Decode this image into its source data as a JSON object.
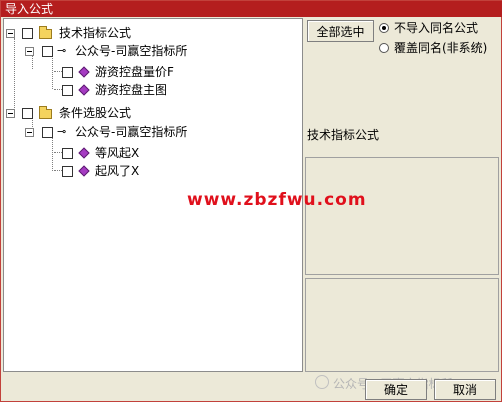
{
  "window": {
    "title": "导入公式"
  },
  "tree": {
    "groups": [
      {
        "label": "技术指标公式",
        "children": [
          {
            "label": "公众号-司赢空指标所",
            "children": [
              {
                "label": "游资控盘量价F"
              },
              {
                "label": "游资控盘主图"
              }
            ]
          }
        ]
      },
      {
        "label": "条件选股公式",
        "children": [
          {
            "label": "公众号-司赢空指标所",
            "children": [
              {
                "label": "等风起X"
              },
              {
                "label": "起风了X"
              }
            ]
          }
        ]
      }
    ]
  },
  "options": {
    "select_all_label": "全部选中",
    "radio_no_import": "不导入同名公式",
    "radio_overwrite": "覆盖同名(非系统)",
    "selected": "radio_no_import"
  },
  "info": {
    "type_label": "技术指标公式"
  },
  "buttons": {
    "ok": "确定",
    "cancel": "取消"
  },
  "overlays": {
    "site_watermark": "www.zbzfwu.com",
    "wechat_watermark": "公众号 · 司赢空指标所"
  },
  "colors": {
    "titlebar": "#B41E1E",
    "watermark": "#E0101C",
    "diamond": "#A53BC2",
    "folder": "#F4D35E"
  }
}
